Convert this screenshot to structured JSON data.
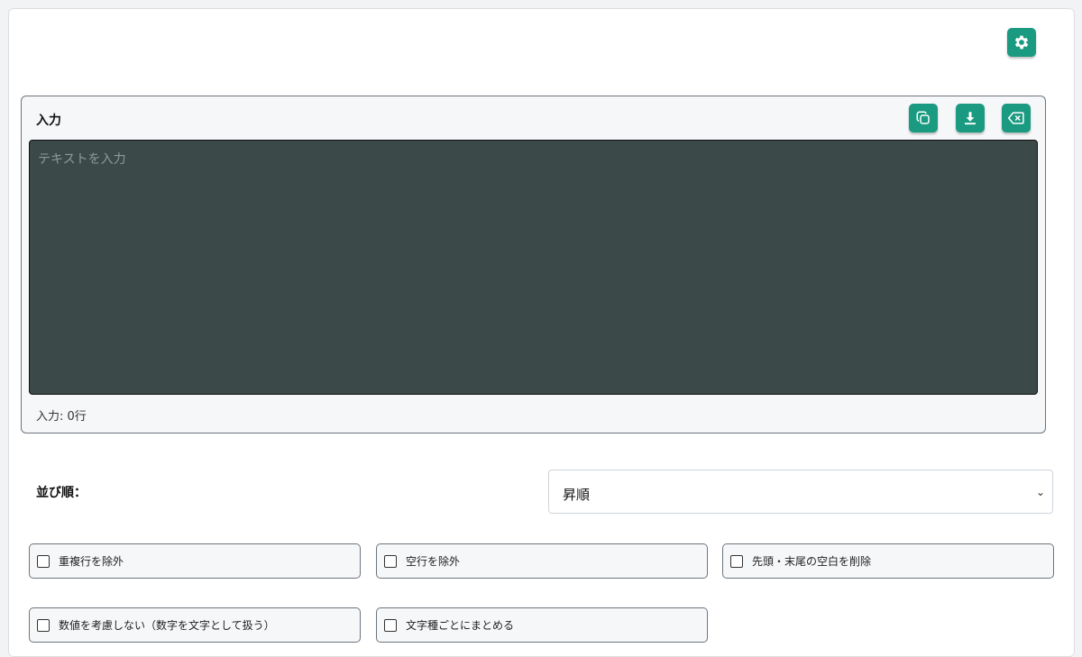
{
  "input_panel": {
    "title": "入力",
    "placeholder": "テキストを入力",
    "line_count": "入力: 0行"
  },
  "icons": {
    "settings": "gear-icon",
    "copy": "copy-icon",
    "download": "download-icon",
    "clear": "backspace-icon"
  },
  "sort": {
    "label": "並び順：",
    "selected": "昇順"
  },
  "options": [
    {
      "label": "重複行を除外",
      "checked": false
    },
    {
      "label": "空行を除外",
      "checked": false
    },
    {
      "label": "先頭・末尾の空白を削除",
      "checked": false
    },
    {
      "label": "数値を考慮しない（数字を文字として扱う）",
      "checked": false
    },
    {
      "label": "文字種ごとにまとめる",
      "checked": false
    }
  ],
  "colors": {
    "accent": "#1a9a80",
    "editor_bg": "#3b4949"
  }
}
